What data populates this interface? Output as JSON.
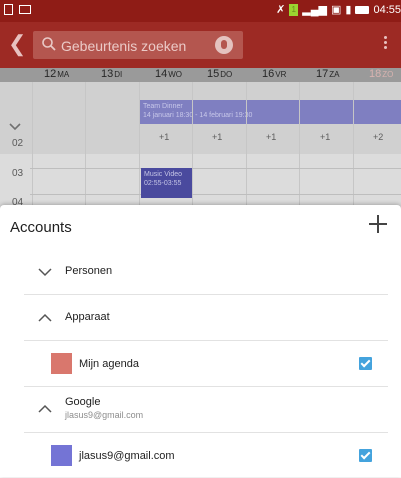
{
  "status_bar": {
    "time": "04:55",
    "sim_label": "1",
    "icons": [
      "image-icon",
      "screen-icon",
      "no-signal-icon",
      "sim1-icon",
      "signal-icon",
      "sim2-icon",
      "sim-signal-icon",
      "battery-icon"
    ]
  },
  "toolbar": {
    "search_placeholder": "Gebeurtenis zoeken",
    "icons": [
      "back-icon",
      "search-icon",
      "mic-icon",
      "overflow-menu-icon"
    ]
  },
  "calendar": {
    "days": [
      {
        "num": "12",
        "weekday": "MA"
      },
      {
        "num": "13",
        "weekday": "DI"
      },
      {
        "num": "14",
        "weekday": "WO"
      },
      {
        "num": "15",
        "weekday": "DO"
      },
      {
        "num": "16",
        "weekday": "VR"
      },
      {
        "num": "17",
        "weekday": "ZA"
      },
      {
        "num": "18",
        "weekday": "ZO"
      }
    ],
    "allday_event": {
      "title": "Team Dinner",
      "time": "14 januari 18:30 - 14 februari 19:30"
    },
    "more_counts": [
      "+1",
      "+1",
      "+1",
      "+1",
      "+2"
    ],
    "hours": [
      "02",
      "03",
      "04"
    ],
    "event": {
      "title": "Music Video",
      "time": "02:55-03:55"
    }
  },
  "accounts_sheet": {
    "title": "Accounts",
    "sections": [
      {
        "label": "Personen",
        "expanded": false
      },
      {
        "label": "Apparaat",
        "expanded": true
      },
      {
        "label": "Google",
        "sub": "jlasus9@gmail.com",
        "expanded": true
      }
    ],
    "calendars": [
      {
        "label": "Mijn agenda",
        "color": "#d9776d",
        "checked": true
      },
      {
        "label": "jlasus9@gmail.com",
        "color": "#7474d5",
        "checked": true
      }
    ]
  },
  "colors": {
    "status_bar": "#8f1c16",
    "toolbar": "#9d2a24",
    "checkbox": "#44a3dd"
  }
}
